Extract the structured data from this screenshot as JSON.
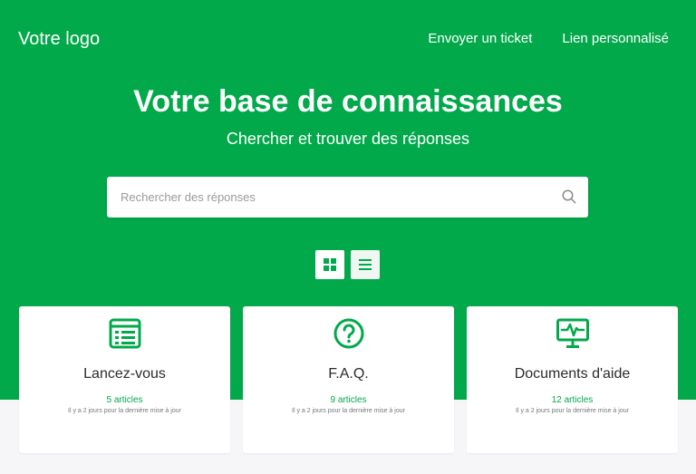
{
  "colors": {
    "brand": "#02a94a",
    "background": "#f6f6f8",
    "card": "#ffffff"
  },
  "header": {
    "logo": "Votre logo",
    "nav": [
      {
        "label": "Envoyer un ticket"
      },
      {
        "label": "Lien personnalisé"
      }
    ]
  },
  "hero": {
    "title": "Votre base de connaissances",
    "subtitle": "Chercher et trouver des réponses"
  },
  "search": {
    "placeholder": "Rechercher des réponses",
    "value": "",
    "icon": "search-icon"
  },
  "view_toggle": {
    "options": [
      {
        "icon": "grid-icon",
        "selected": false
      },
      {
        "icon": "list-icon",
        "selected": true
      }
    ]
  },
  "categories": [
    {
      "icon": "list-document-icon",
      "title": "Lancez-vous",
      "count": "5 articles",
      "updated": "Il y a 2 jours pour la dernière mise à jour"
    },
    {
      "icon": "question-circle-icon",
      "title": "F.A.Q.",
      "count": "9 articles",
      "updated": "Il y a 2 jours pour la dernière mise à jour"
    },
    {
      "icon": "monitor-pulse-icon",
      "title": "Documents d'aide",
      "count": "12 articles",
      "updated": "Il y a 2 jours pour la dernière mise à jour"
    }
  ]
}
